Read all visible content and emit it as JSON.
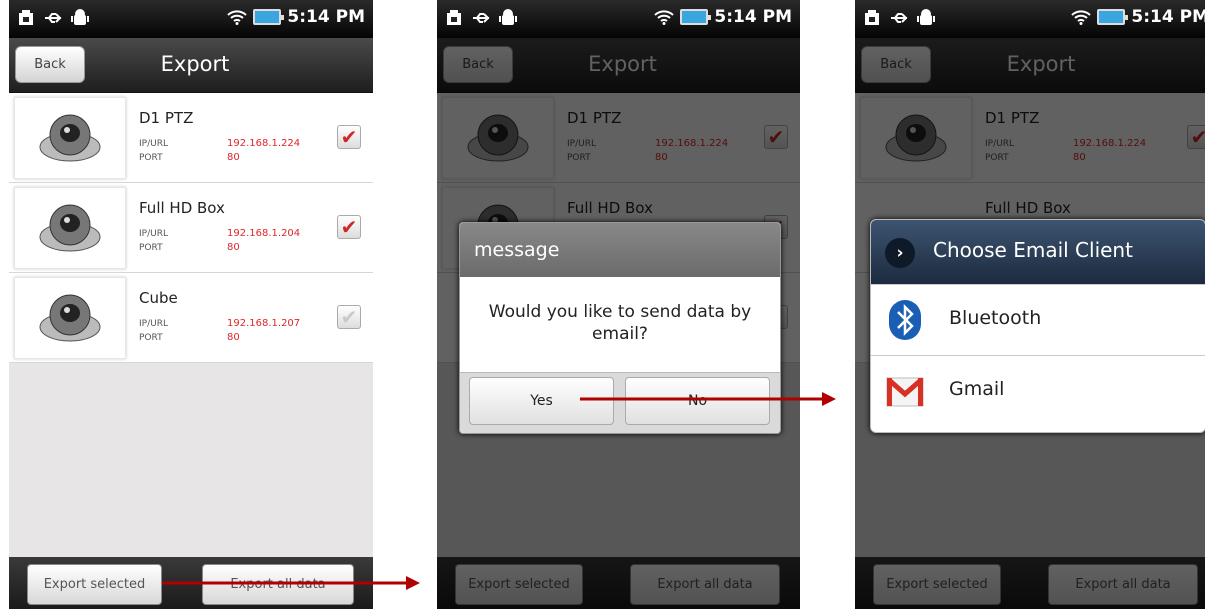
{
  "status_bar": {
    "time": "5:14 PM"
  },
  "screen1": {
    "back_label": "Back",
    "title": "Export",
    "devices": [
      {
        "name": "D1 PTZ",
        "ip_label": "IP/URL",
        "ip": "192.168.1.224",
        "port_label": "PORT",
        "port": "80",
        "checked": true
      },
      {
        "name": "Full HD Box",
        "ip_label": "IP/URL",
        "ip": "192.168.1.204",
        "port_label": "PORT",
        "port": "80",
        "checked": true
      },
      {
        "name": "Cube",
        "ip_label": "IP/URL",
        "ip": "192.168.1.207",
        "port_label": "PORT",
        "port": "80",
        "checked": false
      }
    ],
    "export_selected_label": "Export selected",
    "export_all_label": "Export all data"
  },
  "dialog": {
    "title": "message",
    "message": "Would you like to send data by email?",
    "yes_label": "Yes",
    "no_label": "No"
  },
  "chooser": {
    "title": "Choose Email Client",
    "options": [
      {
        "label": "Bluetooth",
        "icon": "bluetooth-icon"
      },
      {
        "label": "Gmail",
        "icon": "gmail-icon"
      }
    ]
  },
  "colors": {
    "accent_red": "#e0262a",
    "arrow_red": "#b00000"
  }
}
